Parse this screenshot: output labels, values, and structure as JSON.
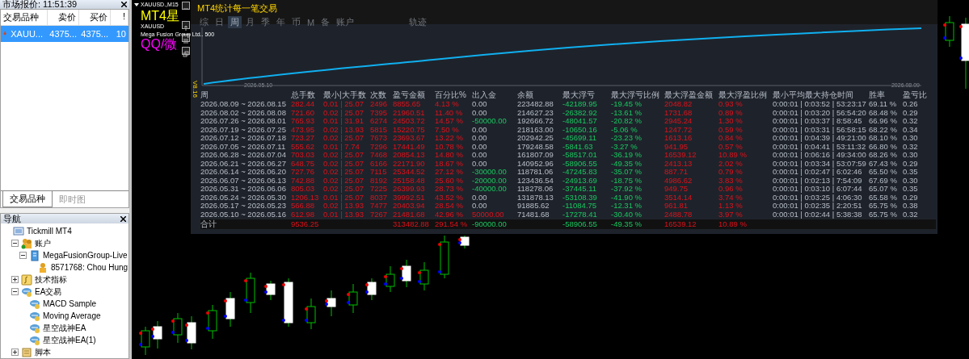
{
  "market_watch": {
    "title": "市场报价: 11:51:39",
    "columns": [
      "交易品种",
      "卖价",
      "买价",
      "!"
    ],
    "rows": [
      {
        "symbol": "XAUU...",
        "bid": "4375...",
        "ask": "4375...",
        "spread": "10",
        "selected": true
      }
    ],
    "tabs": [
      {
        "label": "交易品种",
        "selected": true
      },
      {
        "label": "即时图",
        "selected": false
      }
    ]
  },
  "navigator": {
    "title": "导航",
    "tree": [
      {
        "label": "Tickmill MT4",
        "kind": "root",
        "children": [
          {
            "label": "账户",
            "kind": "accounts",
            "expanded": true,
            "children": [
              {
                "label": "MegaFusionGroup-Live",
                "kind": "server",
                "expanded": true,
                "children": [
                  {
                    "label": "8571768: Chou Hung",
                    "kind": "account"
                  }
                ]
              }
            ]
          },
          {
            "label": "技术指标",
            "kind": "indicators",
            "expanded": false
          },
          {
            "label": "EA交易",
            "kind": "experts",
            "expanded": true,
            "children": [
              {
                "label": "MACD Sample",
                "kind": "expert"
              },
              {
                "label": "Moving Average",
                "kind": "expert"
              },
              {
                "label": "星空战神EA",
                "kind": "expert"
              },
              {
                "label": "星空战神EA(1)",
                "kind": "expert"
              }
            ]
          },
          {
            "label": "脚本",
            "kind": "scripts",
            "expanded": false
          }
        ]
      }
    ]
  },
  "chart": {
    "symbol_label": "XAUUSD.,M15",
    "overlay_texts": [
      {
        "text": "MT4星",
        "kind": "title"
      },
      {
        "text": "XAUUSD",
        "kind": "info"
      },
      {
        "text": "Mega Fusion Group Ltd..  500",
        "kind": "info"
      },
      {
        "text": "QQ/微",
        "kind": "contact"
      }
    ],
    "stats_panel": {
      "title": "MT4统计每一笔交易",
      "version": "V8.16",
      "toolbar": [
        {
          "label": "综",
          "selected": false
        },
        {
          "label": "日",
          "selected": false
        },
        {
          "label": "周",
          "selected": true
        },
        {
          "label": "月",
          "selected": false
        },
        {
          "label": "季",
          "selected": false
        },
        {
          "label": "年",
          "selected": false
        },
        {
          "label": "币",
          "selected": false
        },
        {
          "label": "M",
          "selected": false
        },
        {
          "label": "备",
          "selected": false
        },
        {
          "label": "账户",
          "selected": false
        }
      ],
      "trail_button": "轨迹",
      "equity_curve": {
        "start_label": "2026.05.10",
        "end_label": "2026.08.09"
      },
      "columns": [
        "周",
        "总手数",
        "最小|大手数",
        "次数",
        "盈亏金额",
        "百分比%",
        "出入金",
        "余额",
        "最大浮亏",
        "最大浮亏比例",
        "最大浮盈金额",
        "最大浮盈比例",
        "最小平均最大持仓时间",
        "胜率",
        "盈亏比"
      ],
      "rows": [
        {
          "withdrawal": false,
          "deposit": false,
          "cells": [
            "2026.08.09 ~ 2026.08.15",
            "282.44",
            "0.01 | 25.07",
            "2496",
            "8855.65",
            "4.13 %",
            "0.00",
            "223482.88",
            "-42189.95",
            "-19.45 %",
            "2048.82",
            "0.93 %",
            "0:00:01 | 0:03:52 | 53:23:17",
            "69.11 %",
            "0.26"
          ]
        },
        {
          "withdrawal": false,
          "deposit": false,
          "cells": [
            "2026.08.02 ~ 2026.08.08",
            "721.60",
            "0.02 | 25.07",
            "7395",
            "21960.51",
            "11.40 %",
            "0.00",
            "214627.23",
            "-26382.92",
            "-13.61 %",
            "1731.68",
            "0.89 %",
            "0:00:01 | 0:03:20 | 56:54:20",
            "68.48 %",
            "0.29"
          ]
        },
        {
          "withdrawal": true,
          "deposit": false,
          "cells": [
            "2026.07.26 ~ 2026.08.01",
            "765.93",
            "0.01 | 31.91",
            "6274",
            "24503.72",
            "14.57 %",
            "-50000.00",
            "192666.72",
            "-48041.57",
            "-20.82 %",
            "2945.24",
            "1.30 %",
            "0:00:01 | 0:03:37 | 8:58:45",
            "66.96 %",
            "0.32"
          ]
        },
        {
          "withdrawal": false,
          "deposit": false,
          "cells": [
            "2026.07.19 ~ 2026.07.25",
            "473.95",
            "0.02 | 13.93",
            "5815",
            "15220.75",
            "7.50 %",
            "0.00",
            "218163.00",
            "-10650.16",
            "-5.06 %",
            "1247.72",
            "0.59 %",
            "0:00:01 | 0:03:31 | 56:58:15",
            "68.22 %",
            "0.34"
          ]
        },
        {
          "withdrawal": false,
          "deposit": false,
          "cells": [
            "2026.07.12 ~ 2026.07.18",
            "723.27",
            "0.02 | 25.07",
            "7673",
            "23693.67",
            "13.22 %",
            "0.00",
            "202942.25",
            "-45699.11",
            "-23.23 %",
            "1613.16",
            "0.84 %",
            "0:00:01 | 0:04:39 | 49:21:00",
            "68.10 %",
            "0.30"
          ]
        },
        {
          "withdrawal": false,
          "deposit": false,
          "cells": [
            "2026.07.05 ~ 2026.07.11",
            "555.62",
            "0.01 | 7.74",
            "7296",
            "17441.49",
            "10.78 %",
            "0.00",
            "179248.58",
            "-5841.63",
            "-3.27 %",
            "941.95",
            "0.57 %",
            "0:00:01 | 0:04:41 | 53:11:32",
            "66.80 %",
            "0.32"
          ]
        },
        {
          "withdrawal": false,
          "deposit": false,
          "cells": [
            "2026.06.28 ~ 2026.07.04",
            "703.03",
            "0.02 | 25.07",
            "7468",
            "20854.13",
            "14.80 %",
            "0.00",
            "161807.09",
            "-58517.01",
            "-36.19 %",
            "16539.12",
            "10.89 %",
            "0:00:01 | 0:06:16 | 49:34:00",
            "68.26 %",
            "0.30"
          ]
        },
        {
          "withdrawal": false,
          "deposit": false,
          "cells": [
            "2026.06.21 ~ 2026.06.27",
            "648.75",
            "0.02 | 25.07",
            "6166",
            "22171.90",
            "18.67 %",
            "0.00",
            "140952.96",
            "-58906.55",
            "-49.35 %",
            "2413.13",
            "2.02 %",
            "0:00:01 | 0:03:34 | 53:07:59",
            "67.43 %",
            "0.29"
          ]
        },
        {
          "withdrawal": true,
          "deposit": false,
          "cells": [
            "2026.06.14 ~ 2026.06.20",
            "727.76",
            "0.02 | 25.07",
            "7115",
            "25344.52",
            "27.12 %",
            "-30000.00",
            "118781.06",
            "-47245.83",
            "-35.07 %",
            "887.71",
            "0.79 %",
            "0:00:01 | 0:02:47 | 6:02:46",
            "65.50 %",
            "0.35"
          ]
        },
        {
          "withdrawal": true,
          "deposit": false,
          "cells": [
            "2026.06.07 ~ 2026.06.13",
            "742.88",
            "0.02 | 25.07",
            "8192",
            "25158.48",
            "25.60 %",
            "-20000.00",
            "123436.54",
            "-24913.69",
            "-18.75 %",
            "4986.62",
            "3.83 %",
            "0:00:01 | 0:02:13 | 7:54:09",
            "67.69 %",
            "0.30"
          ]
        },
        {
          "withdrawal": true,
          "deposit": false,
          "cells": [
            "2026.05.31 ~ 2026.06.06",
            "805.03",
            "0.02 | 25.07",
            "7225",
            "26399.93",
            "28.73 %",
            "-40000.00",
            "118278.06",
            "-37445.11",
            "-37.92 %",
            "949.75",
            "0.96 %",
            "0:00:01 | 0:03:10 | 6:07:44",
            "65.07 %",
            "0.35"
          ]
        },
        {
          "withdrawal": false,
          "deposit": false,
          "cells": [
            "2026.05.24 ~ 2026.05.30",
            "1206.13",
            "0.01 | 25.07",
            "8037",
            "39992.51",
            "43.52 %",
            "0.00",
            "131878.13",
            "-53108.39",
            "-41.90 %",
            "3514.14",
            "3.74 %",
            "0:00:01 | 0:03:25 | 4:06:30",
            "65.58 %",
            "0.29"
          ]
        },
        {
          "withdrawal": false,
          "deposit": false,
          "cells": [
            "2026.05.17 ~ 2026.05.23",
            "566.88",
            "0.02 | 13.93",
            "7477",
            "20403.94",
            "28.54 %",
            "0.00",
            "91885.62",
            "-11084.75",
            "-12.31 %",
            "961.81",
            "1.13 %",
            "0:00:01 | 0:02:35 | 2:20:51",
            "65.75 %",
            "0.38"
          ]
        },
        {
          "withdrawal": false,
          "deposit": true,
          "cells": [
            "2026.05.10 ~ 2026.05.16",
            "612.98",
            "0.01 | 13.93",
            "7267",
            "21481.68",
            "42.96 %",
            "50000.00",
            "71481.68",
            "-17278.41",
            "-30.40 %",
            "2488.78",
            "3.97 %",
            "0:00:01 | 0:02:44 | 5:38:38",
            "65.75 %",
            "0.32"
          ]
        }
      ],
      "total": {
        "withdrawal": true,
        "deposit": false,
        "cells": [
          "合计",
          "9536.25",
          null,
          null,
          "313482.88",
          "291.54 %",
          "-90000.00",
          null,
          "-58906.55",
          "-49.35 %",
          "16539.12",
          "10.89 %",
          null,
          null,
          null
        ]
      }
    }
  }
}
